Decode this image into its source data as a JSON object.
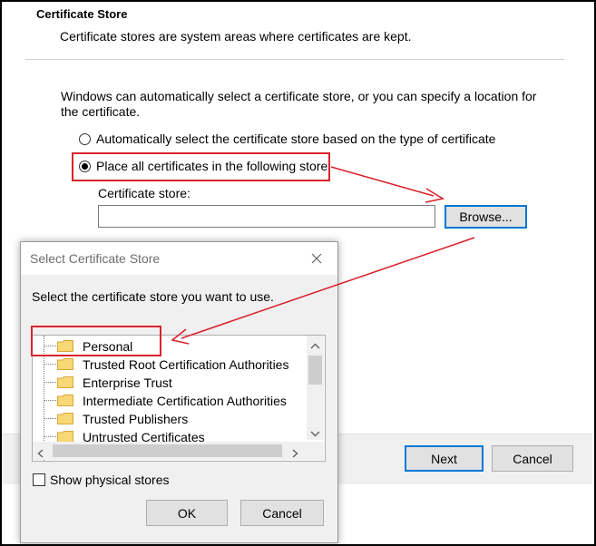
{
  "wizard": {
    "section_title": "Certificate Store",
    "section_subtitle": "Certificate stores are system areas where certificates are kept.",
    "description": "Windows can automatically select a certificate store, or you can specify a location for the certificate.",
    "description_line1": "Windows can automatically select a certificate store, or you can specify a location for",
    "description_line2": "the certificate.",
    "radio_auto_label": "Automatically select the certificate store based on the type of certificate",
    "radio_place_label": "Place all certificates in the following store",
    "radio_selected": "place",
    "store_field_label": "Certificate store:",
    "store_field_value": "",
    "browse_button": "Browse...",
    "next_button": "Next",
    "cancel_button": "Cancel"
  },
  "dialog": {
    "title": "Select Certificate Store",
    "instruction": "Select the certificate store you want to use.",
    "tree_items": [
      "Personal",
      "Trusted Root Certification Authorities",
      "Enterprise Trust",
      "Intermediate Certification Authorities",
      "Trusted Publishers",
      "Untrusted Certificates"
    ],
    "selected_item": "Personal",
    "show_physical_label": "Show physical stores",
    "show_physical_checked": false,
    "ok_button": "OK",
    "cancel_button": "Cancel"
  },
  "colors": {
    "annotation_red": "#d9232d",
    "focus_blue": "#0078d7",
    "folder_yellow": "#f8d775"
  }
}
